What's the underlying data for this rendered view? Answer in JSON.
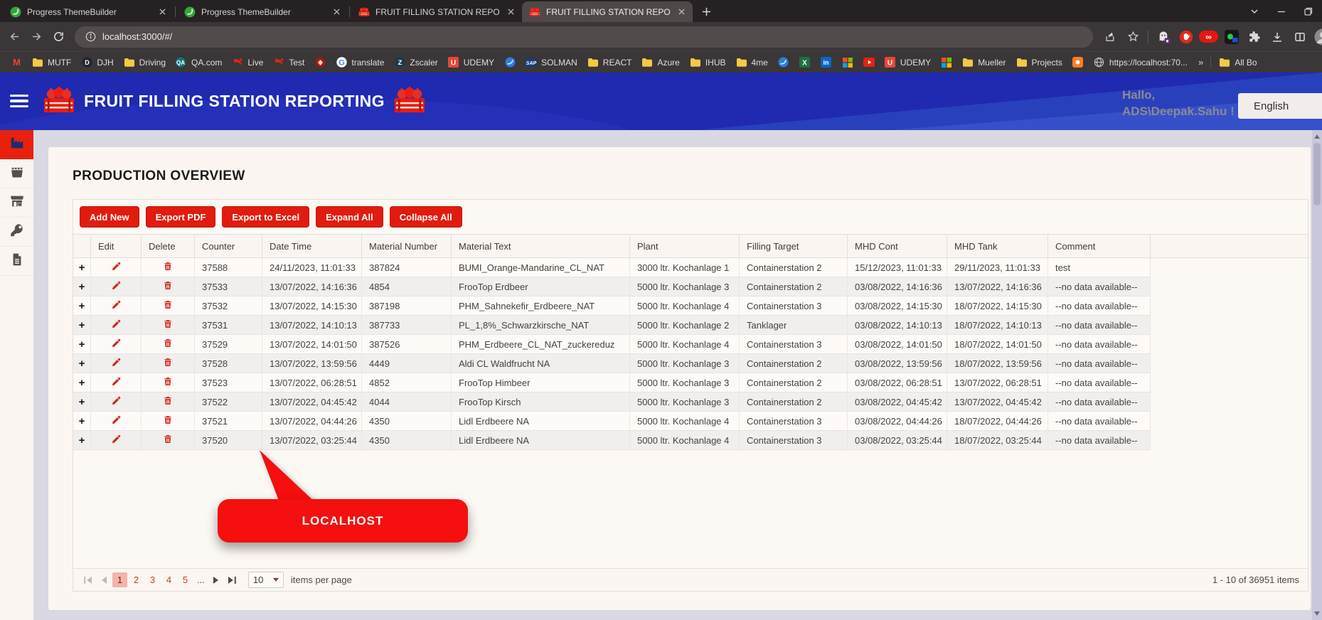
{
  "colors": {
    "accent_red": "#e11b0e",
    "header_blue": "#1f2ab0",
    "callout_red": "#f50f0f",
    "sidebar_active_red": "#e8210d",
    "background_lavender": "#d9d8e3",
    "chrome_dark": "#262122",
    "chrome_mid": "#3b3637"
  },
  "browser": {
    "tabs": [
      {
        "title": "Progress ThemeBuilder",
        "icon": "themebuilder",
        "active": false
      },
      {
        "title": "Progress ThemeBuilder",
        "icon": "themebuilder",
        "active": false
      },
      {
        "title": "FRUIT FILLING STATION REPORTING",
        "icon": "fruit",
        "active": false
      },
      {
        "title": "FRUIT FILLING STATION REPORTING",
        "icon": "fruit",
        "active": true
      }
    ],
    "window_controls": [
      "chevron-down",
      "minimize",
      "restore"
    ],
    "toolbar": {
      "left_icons": [
        "back",
        "forward",
        "refresh"
      ],
      "right_icons": [
        "share",
        "star",
        "divider",
        "ghost",
        "hand",
        "infinity",
        "app",
        "puzzle",
        "download",
        "split",
        "avatar"
      ]
    },
    "address": {
      "icon": "info",
      "url": "localhost:3000/#/"
    },
    "bookmarks": [
      {
        "icon": "m-multi",
        "label": ""
      },
      {
        "icon": "folder",
        "label": "MUTF"
      },
      {
        "icon": "dark-circle",
        "label": "DJH"
      },
      {
        "icon": "folder",
        "label": "Driving"
      },
      {
        "icon": "qa",
        "label": "QA.com"
      },
      {
        "icon": "red-swoosh",
        "label": "Live"
      },
      {
        "icon": "red-swoosh",
        "label": "Test"
      },
      {
        "icon": "red-shape",
        "label": ""
      },
      {
        "icon": "google-g",
        "label": "translate"
      },
      {
        "icon": "zscaler",
        "label": "Zscaler"
      },
      {
        "icon": "udemy",
        "label": "UDEMY"
      },
      {
        "icon": "blue-swirl",
        "label": ""
      },
      {
        "icon": "sap",
        "label": "SOLMAN"
      },
      {
        "icon": "folder",
        "label": "REACT"
      },
      {
        "icon": "folder",
        "label": "Azure"
      },
      {
        "icon": "folder",
        "label": "IHUB"
      },
      {
        "icon": "folder",
        "label": "4me"
      },
      {
        "icon": "blue-swirl",
        "label": ""
      },
      {
        "icon": "excel",
        "label": ""
      },
      {
        "icon": "linkedin",
        "label": ""
      },
      {
        "icon": "ms-grid",
        "label": ""
      },
      {
        "icon": "youtube",
        "label": ""
      },
      {
        "icon": "udemy",
        "label": "UDEMY"
      },
      {
        "icon": "ms-grid",
        "label": ""
      },
      {
        "icon": "folder",
        "label": "Mueller"
      },
      {
        "icon": "folder",
        "label": "Projects"
      },
      {
        "icon": "orange-app",
        "label": ""
      },
      {
        "icon": "globe",
        "label": "https://localhost:70..."
      },
      {
        "icon": "chevron-double",
        "label": ""
      },
      {
        "icon": "divider",
        "label": ""
      },
      {
        "icon": "folder",
        "label": "All Bo"
      }
    ]
  },
  "app": {
    "title": "FRUIT FILLING STATION REPORTING",
    "greeting_line1": "Hallo,",
    "greeting_line2": "ADS\\Deepak.Sahu !",
    "language_button": "English",
    "sidebar": [
      {
        "icon": "factory",
        "active": true
      },
      {
        "icon": "bin",
        "active": false
      },
      {
        "icon": "store-lock",
        "active": false
      },
      {
        "icon": "key",
        "active": false
      },
      {
        "icon": "document",
        "active": false
      }
    ],
    "page": {
      "heading": "PRODUCTION OVERVIEW",
      "toolbar_buttons": [
        "Add New",
        "Export PDF",
        "Export to Excel",
        "Expand All",
        "Collapse All"
      ],
      "table": {
        "columns": [
          "",
          "Edit",
          "Delete",
          "Counter",
          "Date Time",
          "Material Number",
          "Material Text",
          "Plant",
          "Filling Target",
          "MHD Cont",
          "MHD Tank",
          "Comment"
        ],
        "rows": [
          {
            "counter": "37588",
            "date_time": "24/11/2023, 11:01:33",
            "material_number": "387824",
            "material_text": "BUMI_Orange-Mandarine_CL_NAT",
            "plant": "3000 ltr. Kochanlage 1",
            "filling_target": "Containerstation 2",
            "mhd_cont": "15/12/2023, 11:01:33",
            "mhd_tank": "29/11/2023, 11:01:33",
            "comment": "test"
          },
          {
            "counter": "37533",
            "date_time": "13/07/2022, 14:16:36",
            "material_number": "4854",
            "material_text": "FrooTop Erdbeer",
            "plant": "5000 ltr. Kochanlage 3",
            "filling_target": "Containerstation 2",
            "mhd_cont": "03/08/2022, 14:16:36",
            "mhd_tank": "13/07/2022, 14:16:36",
            "comment": "--no data available--"
          },
          {
            "counter": "37532",
            "date_time": "13/07/2022, 14:15:30",
            "material_number": "387198",
            "material_text": "PHM_Sahnekefir_Erdbeere_NAT",
            "plant": "5000 ltr. Kochanlage 4",
            "filling_target": "Containerstation 3",
            "mhd_cont": "03/08/2022, 14:15:30",
            "mhd_tank": "18/07/2022, 14:15:30",
            "comment": "--no data available--"
          },
          {
            "counter": "37531",
            "date_time": "13/07/2022, 14:10:13",
            "material_number": "387733",
            "material_text": "PL_1,8%_Schwarzkirsche_NAT",
            "plant": "5000 ltr. Kochanlage 2",
            "filling_target": "Tanklager",
            "mhd_cont": "03/08/2022, 14:10:13",
            "mhd_tank": "18/07/2022, 14:10:13",
            "comment": "--no data available--"
          },
          {
            "counter": "37529",
            "date_time": "13/07/2022, 14:01:50",
            "material_number": "387526",
            "material_text": "PHM_Erdbeere_CL_NAT_zuckereduz",
            "plant": "5000 ltr. Kochanlage 4",
            "filling_target": "Containerstation 3",
            "mhd_cont": "03/08/2022, 14:01:50",
            "mhd_tank": "18/07/2022, 14:01:50",
            "comment": "--no data available--"
          },
          {
            "counter": "37528",
            "date_time": "13/07/2022, 13:59:56",
            "material_number": "4449",
            "material_text": "Aldi CL Waldfrucht NA",
            "plant": "5000 ltr. Kochanlage 3",
            "filling_target": "Containerstation 2",
            "mhd_cont": "03/08/2022, 13:59:56",
            "mhd_tank": "18/07/2022, 13:59:56",
            "comment": "--no data available--"
          },
          {
            "counter": "37523",
            "date_time": "13/07/2022, 06:28:51",
            "material_number": "4852",
            "material_text": "FrooTop Himbeer",
            "plant": "5000 ltr. Kochanlage 3",
            "filling_target": "Containerstation 2",
            "mhd_cont": "03/08/2022, 06:28:51",
            "mhd_tank": "13/07/2022, 06:28:51",
            "comment": "--no data available--"
          },
          {
            "counter": "37522",
            "date_time": "13/07/2022, 04:45:42",
            "material_number": "4044",
            "material_text": "FrooTop Kirsch",
            "plant": "5000 ltr. Kochanlage 3",
            "filling_target": "Containerstation 2",
            "mhd_cont": "03/08/2022, 04:45:42",
            "mhd_tank": "13/07/2022, 04:45:42",
            "comment": "--no data available--"
          },
          {
            "counter": "37521",
            "date_time": "13/07/2022, 04:44:26",
            "material_number": "4350",
            "material_text": "Lidl Erdbeere NA",
            "plant": "5000 ltr. Kochanlage 4",
            "filling_target": "Containerstation 3",
            "mhd_cont": "03/08/2022, 04:44:26",
            "mhd_tank": "18/07/2022, 04:44:26",
            "comment": "--no data available--"
          },
          {
            "counter": "37520",
            "date_time": "13/07/2022, 03:25:44",
            "material_number": "4350",
            "material_text": "Lidl Erdbeere NA",
            "plant": "5000 ltr. Kochanlage 4",
            "filling_target": "Containerstation 3",
            "mhd_cont": "03/08/2022, 03:25:44",
            "mhd_tank": "18/07/2022, 03:25:44",
            "comment": "--no data available--"
          }
        ]
      },
      "pager": {
        "pages": [
          "1",
          "2",
          "3",
          "4",
          "5"
        ],
        "active_page": "1",
        "ellipsis": "...",
        "page_size": "10",
        "items_per_page_label": "items per page",
        "status": "1 - 10 of 36951 items"
      },
      "callout": "LOCALHOST"
    }
  }
}
